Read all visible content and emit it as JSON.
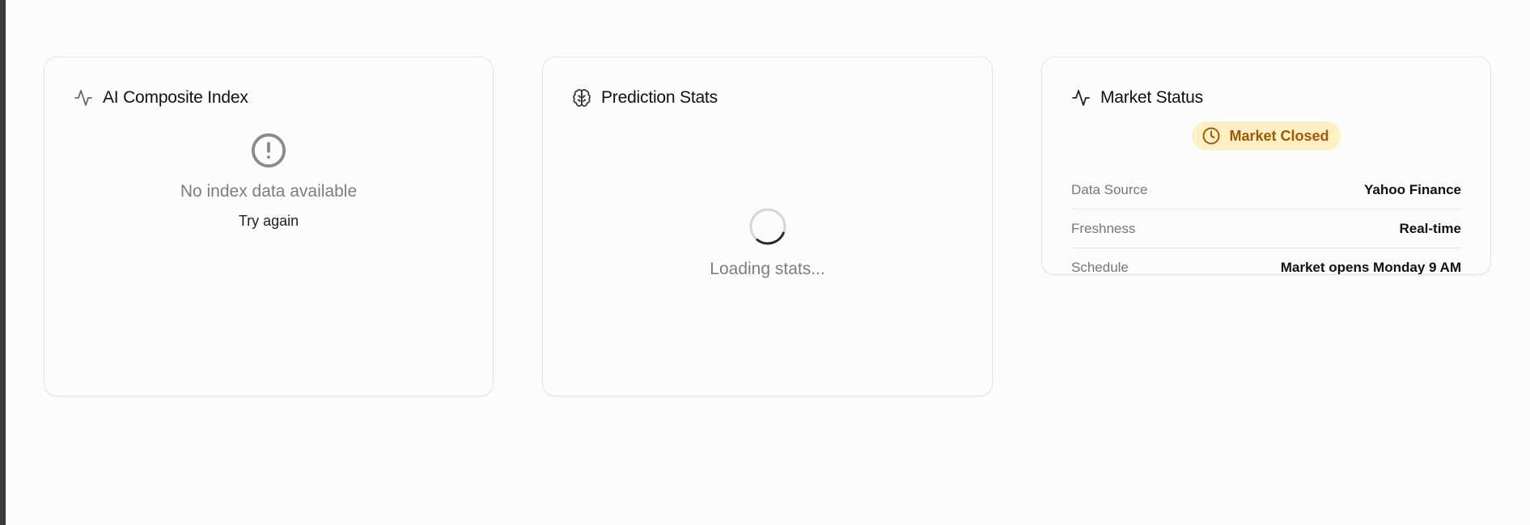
{
  "index_card": {
    "title": "AI Composite Index",
    "icon": "activity-icon",
    "empty_message": "No index data available",
    "retry_label": "Try again"
  },
  "prediction_card": {
    "title": "Prediction Stats",
    "icon": "brain-icon",
    "loading_message": "Loading stats..."
  },
  "market_card": {
    "title": "Market Status",
    "icon": "activity-icon",
    "badge": {
      "label": "Market Closed",
      "icon": "clock-icon",
      "bg": "#fdf0c4",
      "fg": "#a15807"
    },
    "rows": [
      {
        "label": "Data Source",
        "value": "Yahoo Finance"
      },
      {
        "label": "Freshness",
        "value": "Real-time"
      },
      {
        "label": "Schedule",
        "value": "Market opens Monday 9 AM"
      }
    ]
  }
}
